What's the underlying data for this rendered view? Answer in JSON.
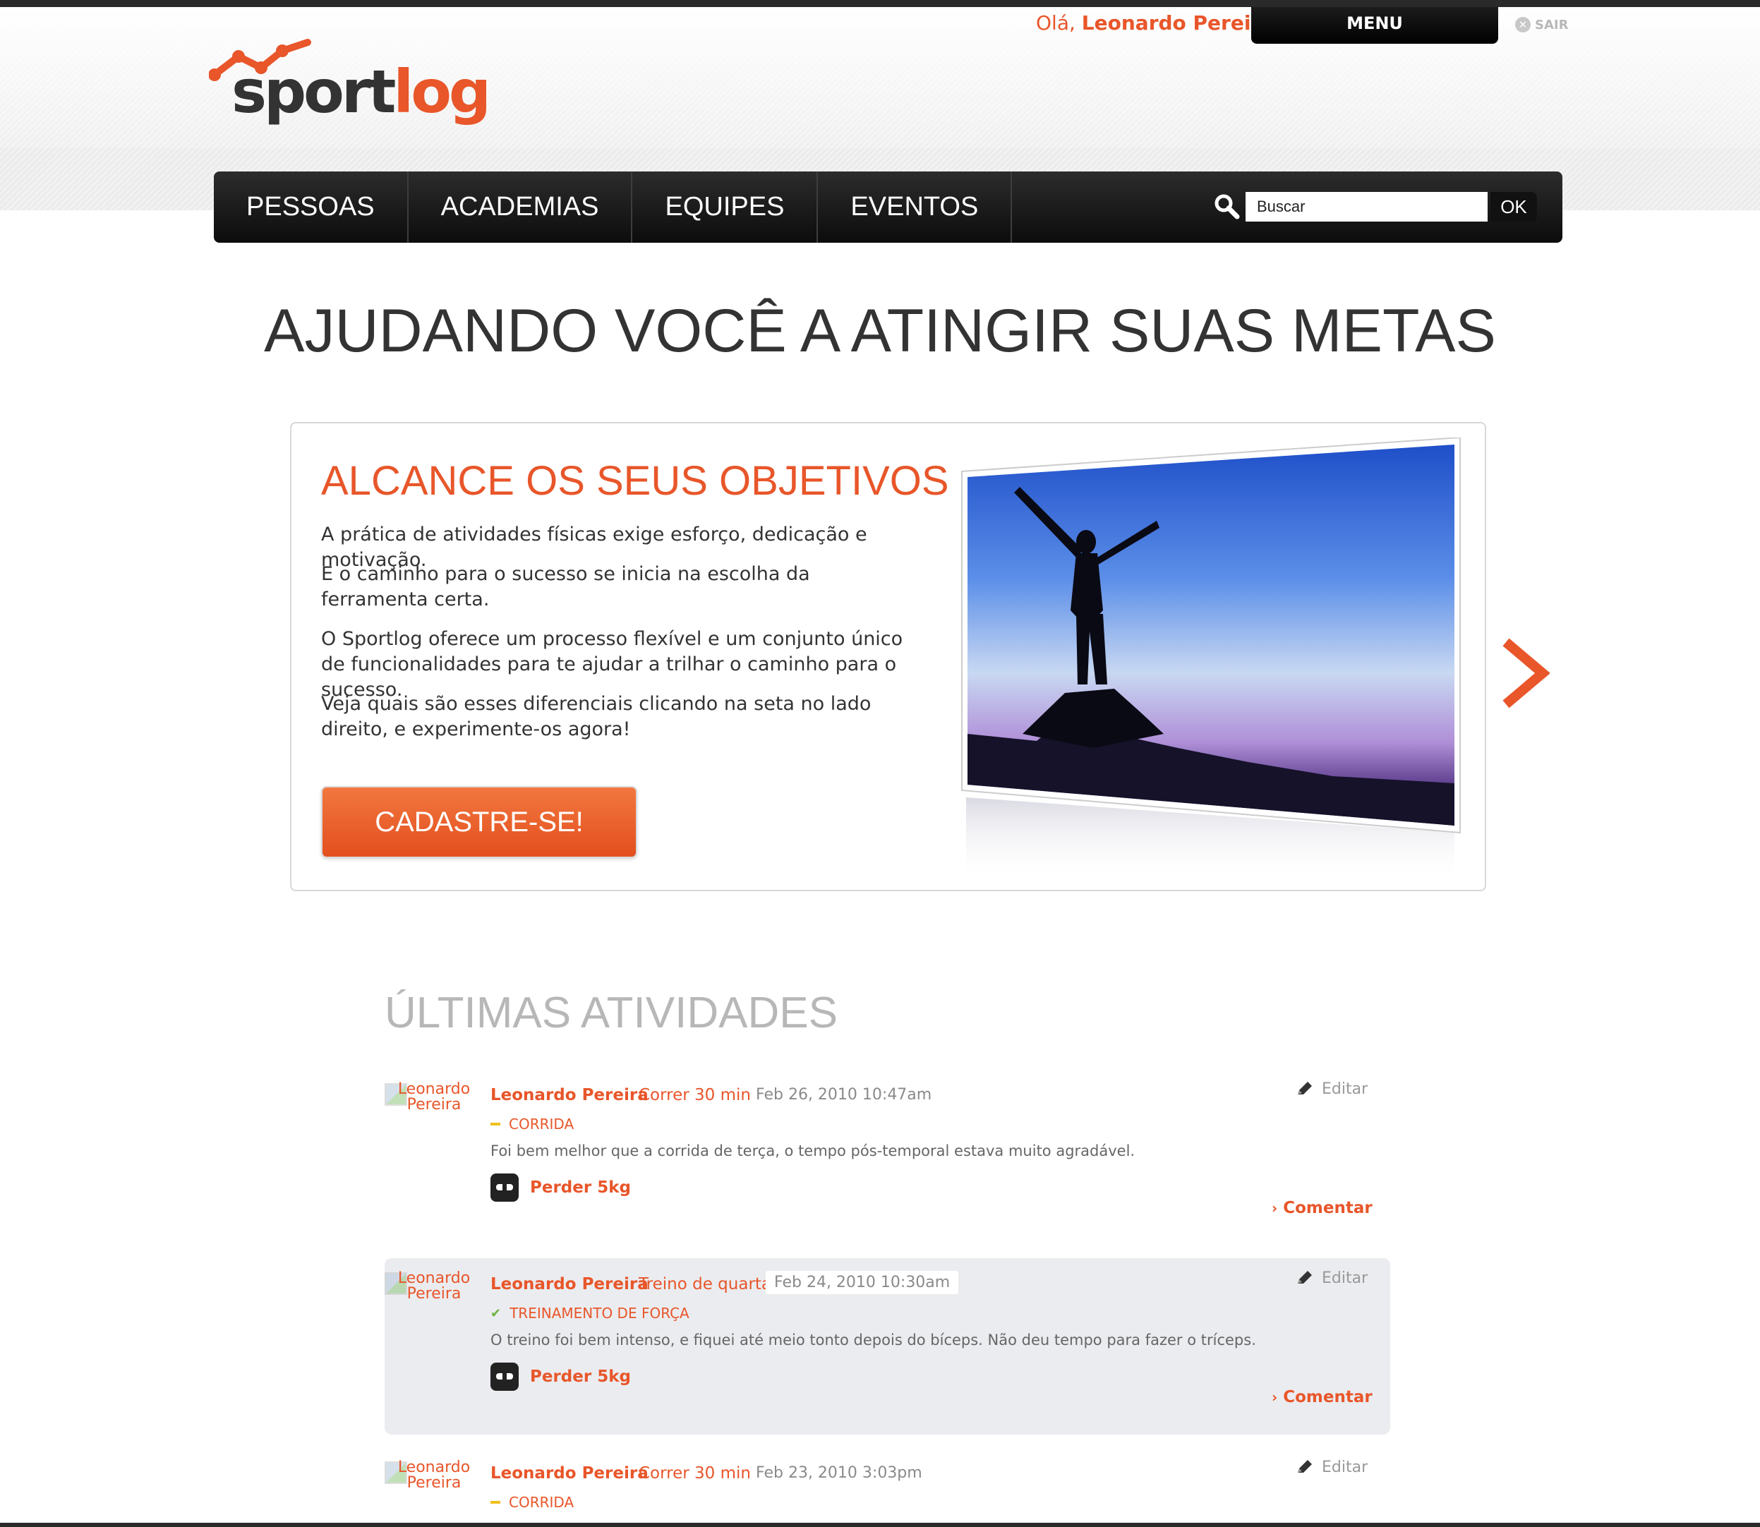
{
  "header": {
    "greeting_prefix": "Olá,",
    "user_name": "Leonardo Pereira",
    "menu_label": "MENU",
    "logout_label": "SAIR",
    "logo_text_sport": "sport",
    "logo_text_log": "log"
  },
  "nav": {
    "items": [
      {
        "label": "PESSOAS"
      },
      {
        "label": "ACADEMIAS"
      },
      {
        "label": "EQUIPES"
      },
      {
        "label": "EVENTOS"
      }
    ],
    "search_placeholder": "Buscar",
    "search_button": "OK"
  },
  "hero": {
    "headline": "AJUDANDO VOCÊ A ATINGIR SUAS METAS",
    "title": "ALCANCE OS SEUS OBJETIVOS",
    "paragraphs": [
      "A prática de atividades físicas exige esforço, dedicação e motivação.",
      "E o caminho para o sucesso se inicia na escolha da ferramenta certa.",
      "O Sportlog oferece um processo flexível e um conjunto único de funcionalidades para te ajudar a trilhar o caminho para o sucesso.",
      "Veja quais são esses diferenciais clicando na seta no lado direito, e experimente-os agora!"
    ],
    "cta_label": "CADASTRE-SE!"
  },
  "activities": {
    "section_title": "ÚLTIMAS ATIVIDADES",
    "edit_label": "Editar",
    "comment_label": "Comentar",
    "items": [
      {
        "avatar_alt": "Leonardo Pereira",
        "author": "Leonardo Pereira",
        "title": "Correr 30 min",
        "date": "Feb 26, 2010 10:47am",
        "category": "CORRIDA",
        "description": "Foi bem melhor que a corrida de terça, o tempo pós-temporal estava muito agradável.",
        "goal": "Perder 5kg"
      },
      {
        "avatar_alt": "Leonardo Pereira",
        "author": "Leonardo Pereira",
        "title": "Treino de quarta",
        "date": "Feb 24, 2010 10:30am",
        "category": "TREINAMENTO DE FORÇA",
        "description": "O treino foi bem intenso, e fiquei até meio tonto depois do bíceps. Não deu tempo para fazer o tríceps.",
        "goal": "Perder 5kg"
      },
      {
        "avatar_alt": "Leonardo Pereira",
        "author": "Leonardo Pereira",
        "title": "Correr 30 min",
        "date": "Feb 23, 2010 3:03pm",
        "category": "CORRIDA"
      }
    ]
  },
  "colors": {
    "brand_orange": "#e8562a",
    "nav_dark": "#111111",
    "muted_gray": "#b7b7b7"
  }
}
